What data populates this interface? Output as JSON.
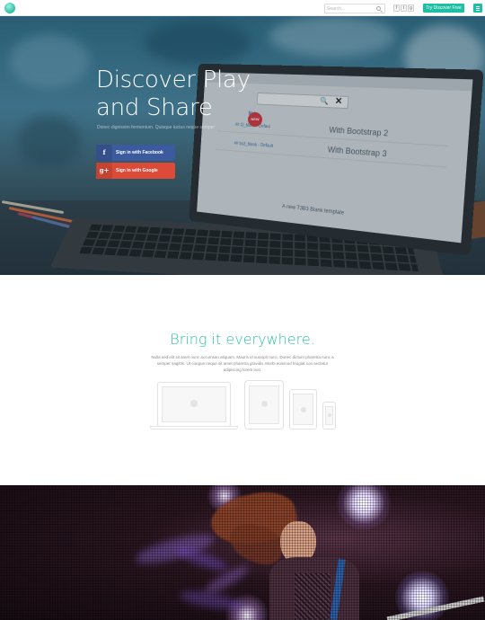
{
  "header": {
    "search_placeholder": "Search...",
    "social_icons": [
      "facebook-icon",
      "twitter-icon",
      "google-icon"
    ],
    "social_glyphs": [
      "f",
      "t",
      "g"
    ],
    "cta_label": "Try Discover Free",
    "accent": "#1fbfa3"
  },
  "hero": {
    "title_line1": "Discover Play",
    "title_line2": "and Share",
    "subtitle": "Donec dignissim fermentum. Quisque luctus neque semper",
    "facebook": {
      "glyph": "f",
      "label": "Sign in with Facebook",
      "color": "#3b5b9e"
    },
    "google": {
      "glyph": "g+",
      "label": "Sign in with Google",
      "color": "#dc4a38"
    },
    "screen": {
      "style_label": "Style",
      "row1_link": "## t3_blank - Defaul",
      "row2_link": "## bs3_blank - Default",
      "row1_text": "With Bootstrap 2",
      "row2_text": "With Bootstrap 3",
      "badge": "NEW",
      "caption": "A new T3B3 Blank template"
    }
  },
  "features": {
    "title": "Bring it everywhere.",
    "text": "Nulla sed elit sit amet nunc accumsan aliquam. Mauris id suscipit nunc. Donec dictum pharetra nunc a semper sagittis. Ut congue neque sit amet pharetra gravida. Morbi euismod feugiat con sectetur adipiscing lorem non."
  }
}
